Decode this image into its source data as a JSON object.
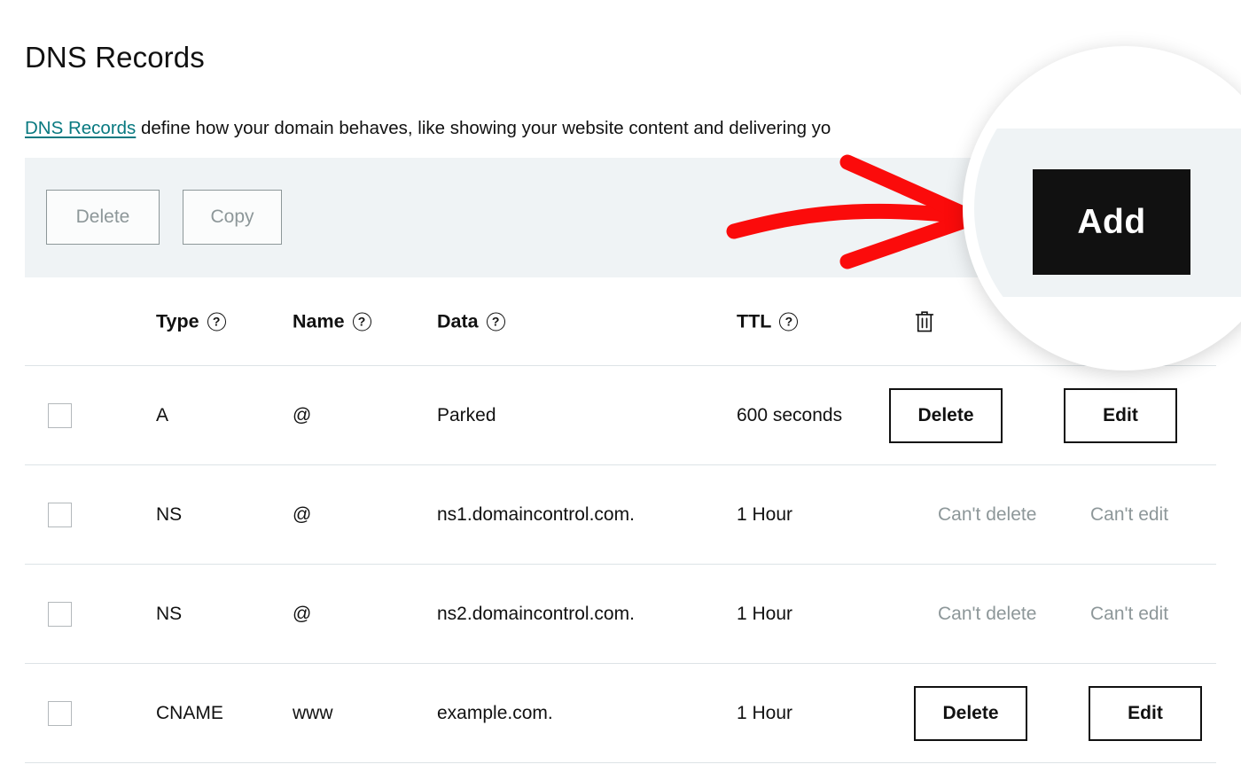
{
  "page": {
    "title": "DNS Records",
    "description_link": "DNS Records",
    "description_rest": " define how your domain behaves, like showing your website content and delivering yo"
  },
  "toolbar": {
    "delete_label": "Delete",
    "copy_label": "Copy",
    "add_label": "Add",
    "background_color": "#eff3f5",
    "add_button_color": "#111111"
  },
  "magnifier": {
    "add_label": "Add",
    "callout_color": "#fb0b0b"
  },
  "table": {
    "headers": {
      "checkbox": "",
      "type": "Type",
      "name": "Name",
      "data": "Data",
      "ttl": "TTL",
      "actions": "trash-icon",
      "help_glyph": "?"
    },
    "rows": [
      {
        "type": "A",
        "name": "@",
        "data": "Parked",
        "ttl": "600 seconds",
        "action_delete": "Delete",
        "action_edit": "Edit",
        "editable": true
      },
      {
        "type": "NS",
        "name": "@",
        "data": "ns1.domaincontrol.com.",
        "ttl": "1 Hour",
        "action_delete": "Can't delete",
        "action_edit": "Can't edit",
        "editable": false
      },
      {
        "type": "NS",
        "name": "@",
        "data": "ns2.domaincontrol.com.",
        "ttl": "1 Hour",
        "action_delete": "Can't delete",
        "action_edit": "Can't edit",
        "editable": false
      },
      {
        "type": "CNAME",
        "name": "www",
        "data": "example.com.",
        "ttl": "1 Hour",
        "action_delete": "Delete",
        "action_edit": "Edit",
        "editable": true
      }
    ]
  }
}
